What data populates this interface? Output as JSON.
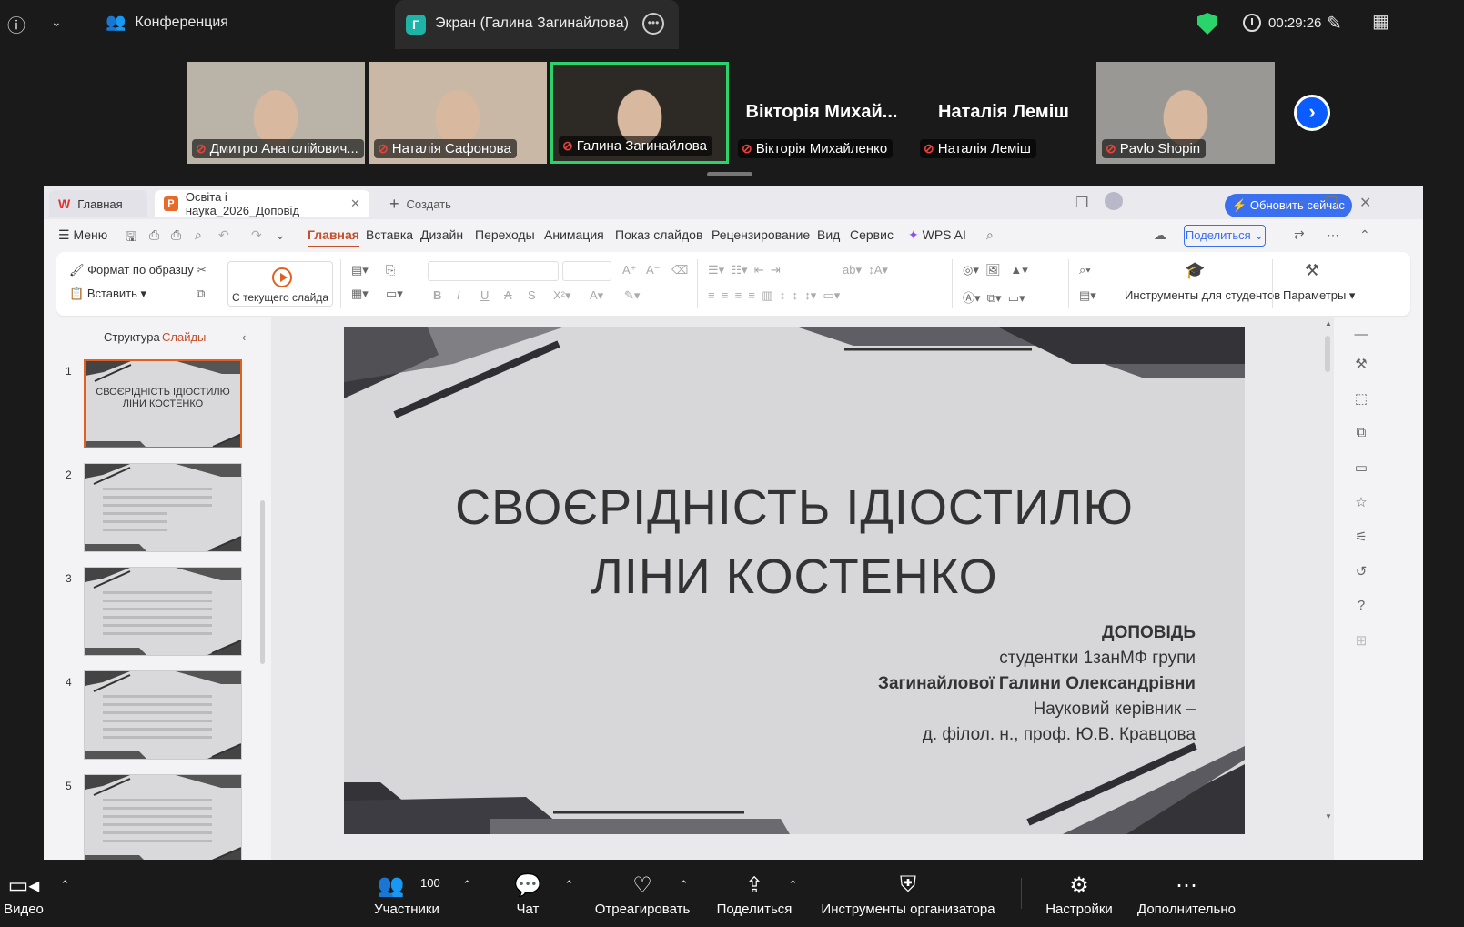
{
  "meeting": {
    "conference_label": "Конференция",
    "screen_badge": "Г",
    "screen_label": "Экран (Галина Загинайлова)",
    "timer": "00:29:26"
  },
  "participants": [
    {
      "name": "Дмитро Анатолійович...",
      "video": true,
      "bg": "#b9b3a8"
    },
    {
      "name": "Наталія Сафонова",
      "video": true,
      "bg": "#c9b8a6"
    },
    {
      "name": "Галина Загинайлова",
      "video": true,
      "bg": "#2d2a26",
      "active": true
    },
    {
      "name": "Вікторія Михайленко",
      "video": false,
      "big": "Вікторія Михай..."
    },
    {
      "name": "Наталія Леміш",
      "video": false,
      "big": "Наталія Леміш"
    },
    {
      "name": "Pavlo Shopin",
      "video": true,
      "bg": "#9a9894"
    }
  ],
  "app": {
    "tabs": {
      "home": "Главная",
      "doc": "Освіта і наука_2026_Доповід",
      "new": "Создать"
    },
    "update_btn": "Обновить сейчас",
    "menu": {
      "menu": "Меню",
      "home": "Главная",
      "insert": "Вставка",
      "design": "Дизайн",
      "transitions": "Переходы",
      "animation": "Анимация",
      "show": "Показ слайдов",
      "review": "Рецензирование",
      "view": "Вид",
      "service": "Сервис",
      "wps_ai": "WPS AI"
    },
    "share": "Поделиться",
    "ribbon": {
      "format_painter": "Формат по образцу",
      "paste": "Вставить",
      "from_current": "С текущего слайда",
      "student_tools": "Инструменты для студентов",
      "params": "Параметры"
    },
    "panel": {
      "structure": "Структура",
      "slides": "Слайды"
    },
    "thumbs": [
      {
        "num": "1",
        "title": "СВОЄРІДНІСТЬ ІДІОСТИЛЮ ЛІНИ КОСТЕНКО"
      },
      {
        "num": "2",
        "title": ""
      },
      {
        "num": "3",
        "title": ""
      },
      {
        "num": "4",
        "title": ""
      },
      {
        "num": "5",
        "title": ""
      }
    ],
    "slide": {
      "title_line1": "СВОЄРІДНІСТЬ ІДІОСТИЛЮ",
      "title_line2": "ЛІНИ КОСТЕНКО",
      "info": [
        "ДОПОВІДЬ",
        "студентки 1занМФ групи",
        "Загинайлової Галини Олександрівни",
        "Науковий керівник –",
        "д. філол. н., проф. Ю.В. Кравцова"
      ]
    }
  },
  "toolbar": {
    "video": "Видео",
    "participants": "Участники",
    "participants_count": "100",
    "chat": "Чат",
    "react": "Отреагировать",
    "share": "Поделиться",
    "host_tools": "Инструменты организатора",
    "settings": "Настройки",
    "more": "Дополнительно"
  },
  "colors": {
    "accent": "#c3502b",
    "zoom_blue": "#0b5cff",
    "active_border": "#2bd36b"
  }
}
